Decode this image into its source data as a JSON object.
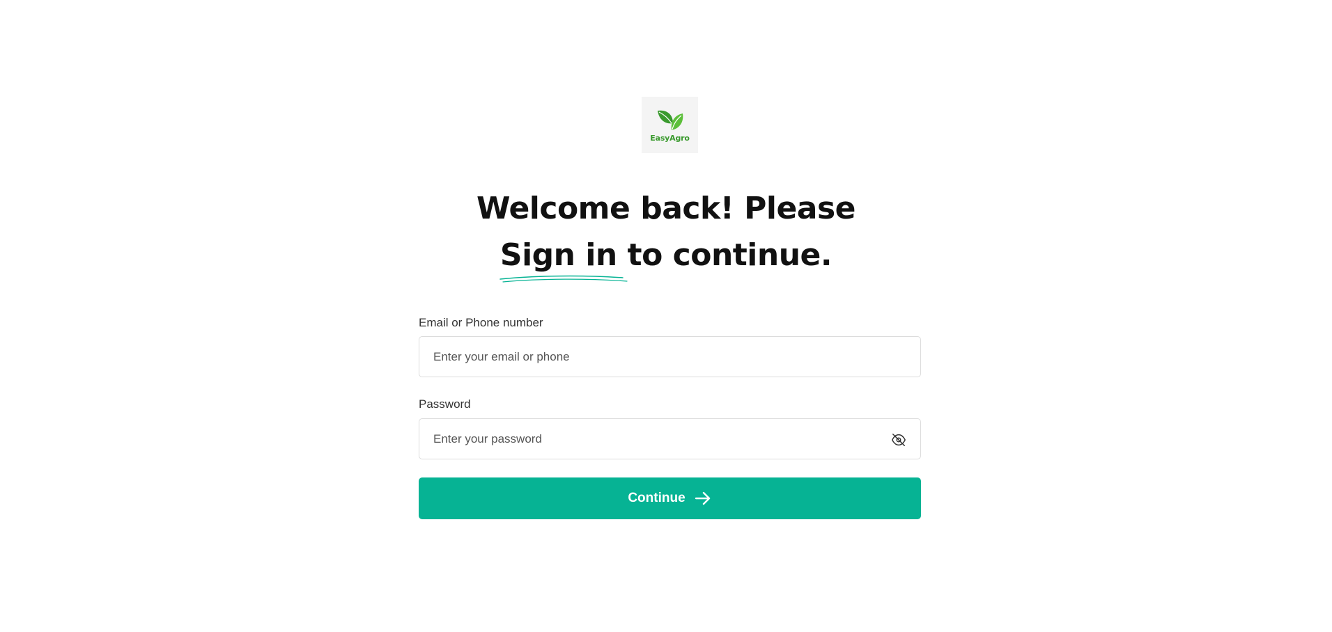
{
  "logo": {
    "text": "EasyAgro",
    "icon": "leaf-icon",
    "color": "#3a9a2e"
  },
  "headline": {
    "line1": "Welcome back! Please",
    "highlight": "Sign in",
    "line2_rest": " to continue."
  },
  "email": {
    "label": "Email or Phone number",
    "placeholder": "Enter your email or phone",
    "value": ""
  },
  "password": {
    "label": "Password",
    "placeholder": "Enter your password",
    "value": "",
    "toggle_icon": "eye-off-icon"
  },
  "continue_button": {
    "label": "Continue",
    "icon": "arrow-right-icon",
    "color": "#06b394"
  },
  "colors": {
    "accent": "#06b394",
    "underline": "#06b394",
    "text": "#111111"
  }
}
